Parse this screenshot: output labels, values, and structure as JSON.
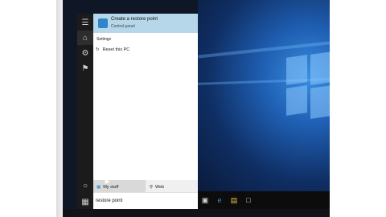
{
  "start_menu": {
    "top_result": {
      "title": "Create a restore point",
      "subtitle": "Control panel"
    },
    "settings_header": "Settings",
    "settings_item": "Reset this PC",
    "filters": {
      "my_stuff": "My stuff",
      "web": "Web"
    },
    "search": {
      "value": "restore point"
    }
  },
  "taskbar": {
    "icons": [
      "task-view-icon",
      "edge-icon",
      "file-explorer-icon",
      "store-icon"
    ]
  },
  "colors": {
    "accent": "#2e86c8",
    "result_highlight": "#b5d7e9",
    "desktop_blue": "#1f5fb3"
  }
}
